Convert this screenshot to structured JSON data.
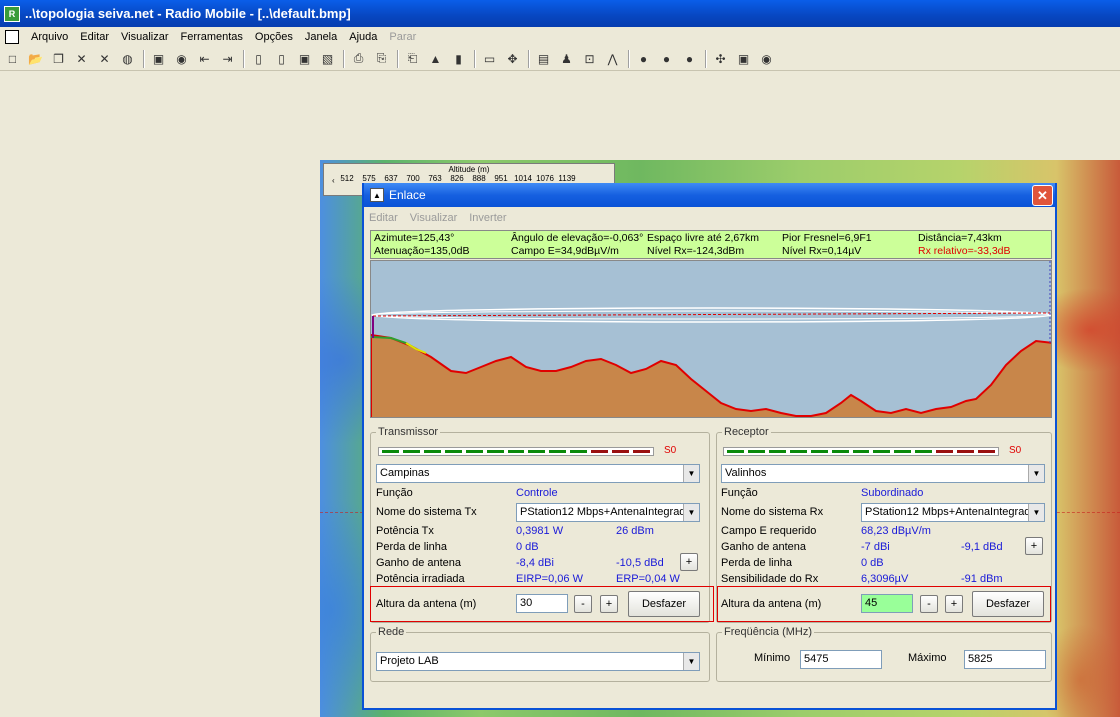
{
  "window": {
    "title": "..\\topologia seiva.net - Radio Mobile - [..\\default.bmp]"
  },
  "menu": [
    "Arquivo",
    "Editar",
    "Visualizar",
    "Ferramentas",
    "Opções",
    "Janela",
    "Ajuda",
    "Parar"
  ],
  "toolbar_icons": [
    "new-icon",
    "open-icon",
    "copy-map-icon",
    "network-icon",
    "units-icon",
    "globe-icon",
    "save-icon",
    "disk-icon",
    "first-icon",
    "last-icon",
    "page-icon",
    "page-edit-icon",
    "save-all-icon",
    "pdf-icon",
    "print-icon",
    "copy-icon",
    "paste-icon",
    "elevation-icon",
    "gradient-icon",
    "ruler-icon",
    "crosshair-icon",
    "table-icon",
    "person-icon",
    "fit-icon",
    "radio-link-icon",
    "globe-green-icon",
    "earth-icon",
    "sphere-icon",
    "grid-icon",
    "book-icon",
    "globe-search-icon"
  ],
  "legend": {
    "title": "Altitude (m)",
    "ticks": [
      "512",
      "575",
      "637",
      "700",
      "763",
      "826",
      "888",
      "951",
      "1014",
      "1076",
      "1139"
    ]
  },
  "dialog": {
    "title": "Enlace",
    "menu": [
      "Editar",
      "Visualizar",
      "Inverter"
    ],
    "info": {
      "row1": [
        "Azimute=125,43°",
        "Ângulo de elevação=-0,063°",
        "Espaço livre até 2,67km",
        "Pior Fresnel=6,9F1",
        "Distância=7,43km"
      ],
      "row2": [
        "Atenuação=135,0dB",
        "Campo E=34,9dBµV/m",
        "Nível Rx=-124,3dBm",
        "Nível Rx=0,14µV",
        "Rx relativo=-33,3dB"
      ]
    },
    "transmitter": {
      "group_label": "Transmissor",
      "s_level": "S0",
      "unit": "Campinas",
      "labels": {
        "function": "Função",
        "system": "Nome do sistema Tx",
        "power": "Potência Tx",
        "line_loss": "Perda de linha",
        "antenna_gain": "Ganho de antena",
        "radiated": "Potência irradiada",
        "height": "Altura da antena (m)"
      },
      "values": {
        "function": "Controle",
        "system": "PStation12 Mbps+AntenaIntegrad",
        "power_w": "0,3981 W",
        "power_dbm": "26 dBm",
        "line_loss": "0 dB",
        "gain_dbi": "-8,4 dBi",
        "gain_dbd": "-10,5 dBd",
        "eirp": "EIRP=0,06 W",
        "erp": "ERP=0,04 W",
        "height": "30"
      }
    },
    "receiver": {
      "group_label": "Receptor",
      "s_level": "S0",
      "unit": "Valinhos",
      "labels": {
        "function": "Função",
        "system": "Nome do sistema Rx",
        "field": "Campo E requerido",
        "antenna_gain": "Ganho de antena",
        "line_loss": "Perda de linha",
        "sensitivity": "Sensibilidade do Rx",
        "height": "Altura da antena (m)"
      },
      "values": {
        "function": "Subordinado",
        "system": "PStation12 Mbps+AntenaIntegrad",
        "field": "68,23 dBµV/m",
        "gain_dbi": "-7 dBi",
        "gain_dbd": "-9,1 dBd",
        "line_loss": "0 dB",
        "sens_uv": "6,3096µV",
        "sens_dbm": "-91 dBm",
        "height": "45"
      }
    },
    "buttons": {
      "plus": "+",
      "minus": "-",
      "undo": "Desfazer"
    },
    "network": {
      "group_label": "Rede",
      "value": "Projeto LAB"
    },
    "frequency": {
      "group_label": "Freqüência (MHz)",
      "min_label": "Mínimo",
      "min": "5475",
      "max_label": "Máximo",
      "max": "5825"
    }
  }
}
